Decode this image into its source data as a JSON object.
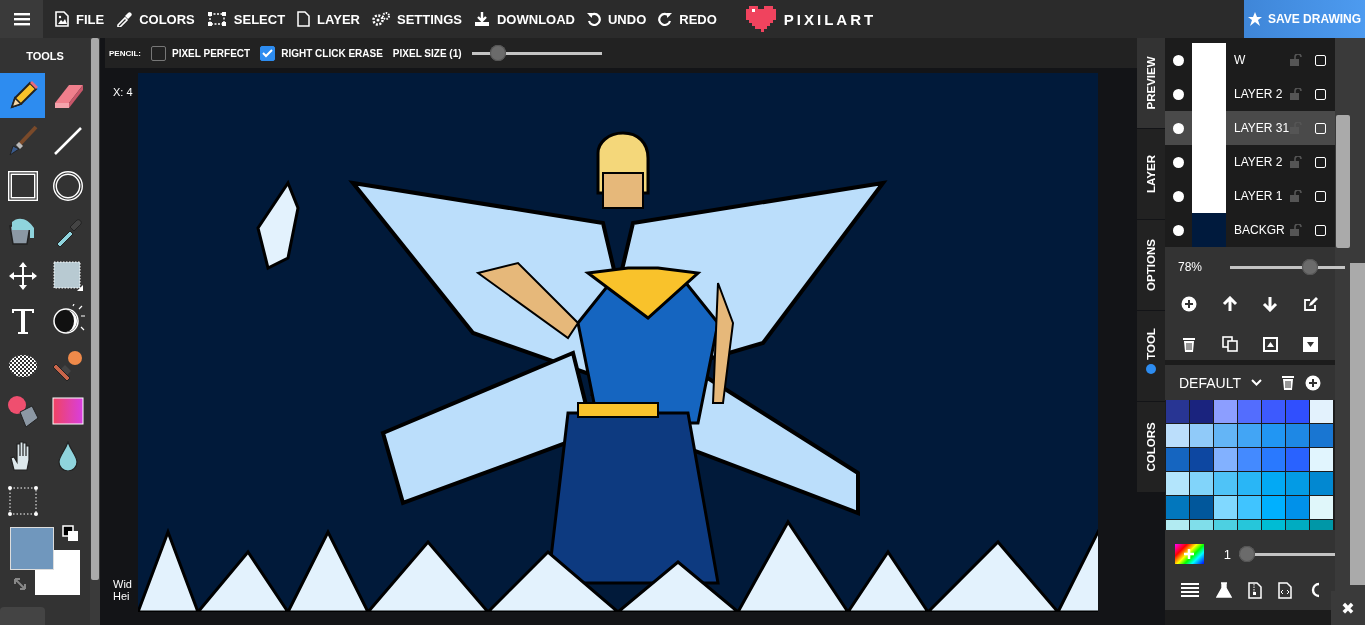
{
  "menu": [
    {
      "kind": "hamburger"
    },
    {
      "kind": "file",
      "label": "FILE"
    },
    {
      "kind": "colors",
      "label": "COLORS"
    },
    {
      "kind": "select",
      "label": "SELECT"
    },
    {
      "kind": "layer",
      "label": "LAYER"
    },
    {
      "kind": "settings",
      "label": "SETTINGS"
    },
    {
      "kind": "download",
      "label": "DOWNLOAD"
    },
    {
      "kind": "undo",
      "label": "UNDO"
    },
    {
      "kind": "redo",
      "label": "REDO"
    }
  ],
  "logo": {
    "text": "PIXILART"
  },
  "save_button": {
    "label": "SAVE DRAWING"
  },
  "tools_panel": {
    "title": "TOOLS",
    "tools": [
      {
        "kind": "pencil",
        "selected": true
      },
      {
        "kind": "eraser",
        "selected": false
      },
      {
        "kind": "brush",
        "selected": false
      },
      {
        "kind": "line",
        "selected": false
      },
      {
        "kind": "rectangle",
        "selected": false
      },
      {
        "kind": "circle",
        "selected": false
      },
      {
        "kind": "bucket",
        "selected": false
      },
      {
        "kind": "eyedropper",
        "selected": false
      },
      {
        "kind": "move",
        "selected": false
      },
      {
        "kind": "select",
        "selected": false
      },
      {
        "kind": "text",
        "selected": false
      },
      {
        "kind": "lighten",
        "selected": false
      },
      {
        "kind": "dither",
        "selected": false
      },
      {
        "kind": "stamp",
        "selected": false
      },
      {
        "kind": "spray",
        "selected": false
      },
      {
        "kind": "gradient",
        "selected": false
      },
      {
        "kind": "hand",
        "selected": false
      },
      {
        "kind": "blur",
        "selected": false
      },
      {
        "kind": "marquee",
        "selected": false
      }
    ],
    "colors": [
      {
        "kind": "primary",
        "color": "#7097bd"
      },
      {
        "kind": "secondary",
        "color": "#ffffff"
      }
    ]
  },
  "options": {
    "tool_label": "PENCIL:",
    "checkboxes": [
      {
        "label": "PIXEL PERFECT",
        "checked": false
      },
      {
        "label": "RIGHT CLICK ERASE",
        "checked": true
      }
    ],
    "pixel_size": {
      "label": "PIXEL SIZE (1)",
      "level": 0.16
    }
  },
  "canvas": {
    "coords": "X: 4",
    "width_label": "Wid",
    "height_label": "Hei"
  },
  "tabs": [
    {
      "label": "PREVIEW",
      "selected": true,
      "indicator": false
    },
    {
      "label": "LAYER",
      "selected": false,
      "indicator": false
    },
    {
      "label": "OPTIONS",
      "selected": false,
      "indicator": false
    },
    {
      "label": "TOOL",
      "selected": false,
      "indicator": true
    },
    {
      "label": "COLORS",
      "selected": false,
      "indicator": false
    }
  ],
  "layers": {
    "items": [
      {
        "name": "W",
        "selected": false,
        "visible": true,
        "checked": false,
        "color": "#ffffff"
      },
      {
        "name": "LAYER 2",
        "selected": false,
        "visible": true,
        "checked": false,
        "color": "#ffffff"
      },
      {
        "name": "LAYER 31",
        "selected": true,
        "visible": true,
        "checked": false,
        "color": "#ffffff"
      },
      {
        "name": "LAYER 2",
        "selected": false,
        "visible": true,
        "checked": false,
        "color": "#ffffff"
      },
      {
        "name": "LAYER 1",
        "selected": false,
        "visible": true,
        "checked": false,
        "color": "#ffffff"
      },
      {
        "name": "BACKGR",
        "selected": false,
        "visible": true,
        "checked": false,
        "color": "#001a3d"
      }
    ],
    "opacity": {
      "reading": "78%",
      "level": 0.73
    },
    "actions": [
      {
        "kind": "add"
      },
      {
        "kind": "up"
      },
      {
        "kind": "down"
      },
      {
        "kind": "edit"
      },
      {
        "kind": "delete"
      },
      {
        "kind": "duplicate"
      },
      {
        "kind": "merge-up"
      },
      {
        "kind": "merge-down"
      }
    ]
  },
  "palette": {
    "name": "DEFAULT",
    "swatches": [
      {
        "color": "#283593"
      },
      {
        "color": "#1a237e"
      },
      {
        "color": "#8c9eff"
      },
      {
        "color": "#536dfe"
      },
      {
        "color": "#3d5afe"
      },
      {
        "color": "#304ffe"
      },
      {
        "color": "#e3f2fd"
      },
      {
        "color": "#bbdefb"
      },
      {
        "color": "#90caf9"
      },
      {
        "color": "#64b5f6"
      },
      {
        "color": "#42a5f5"
      },
      {
        "color": "#2196f3"
      },
      {
        "color": "#1e88e5"
      },
      {
        "color": "#1976d2"
      },
      {
        "color": "#1565c0"
      },
      {
        "color": "#0d47a1"
      },
      {
        "color": "#82b1ff"
      },
      {
        "color": "#448aff"
      },
      {
        "color": "#2979ff"
      },
      {
        "color": "#2962ff"
      },
      {
        "color": "#e1f5fe"
      },
      {
        "color": "#b3e5fc"
      },
      {
        "color": "#81d4fa"
      },
      {
        "color": "#4fc3f7"
      },
      {
        "color": "#29b6f6"
      },
      {
        "color": "#03a9f4"
      },
      {
        "color": "#039be5"
      },
      {
        "color": "#0288d1"
      },
      {
        "color": "#0277bd"
      },
      {
        "color": "#01579b"
      },
      {
        "color": "#80d8ff"
      },
      {
        "color": "#40c4ff"
      },
      {
        "color": "#00b0ff"
      },
      {
        "color": "#0091ea"
      },
      {
        "color": "#e0f7fa"
      },
      {
        "color": "#b2ebf2"
      },
      {
        "color": "#80deea"
      },
      {
        "color": "#4dd0e1"
      },
      {
        "color": "#26c6da"
      },
      {
        "color": "#00bcd4"
      },
      {
        "color": "#00acc1"
      },
      {
        "color": "#0097a7"
      }
    ],
    "brush_size": {
      "reading": "1",
      "level": 0
    },
    "actions": [
      {
        "kind": "list"
      },
      {
        "kind": "flask"
      },
      {
        "kind": "zip"
      },
      {
        "kind": "code"
      },
      {
        "kind": "circle"
      }
    ]
  },
  "close_button": {
    "label": "✖"
  }
}
